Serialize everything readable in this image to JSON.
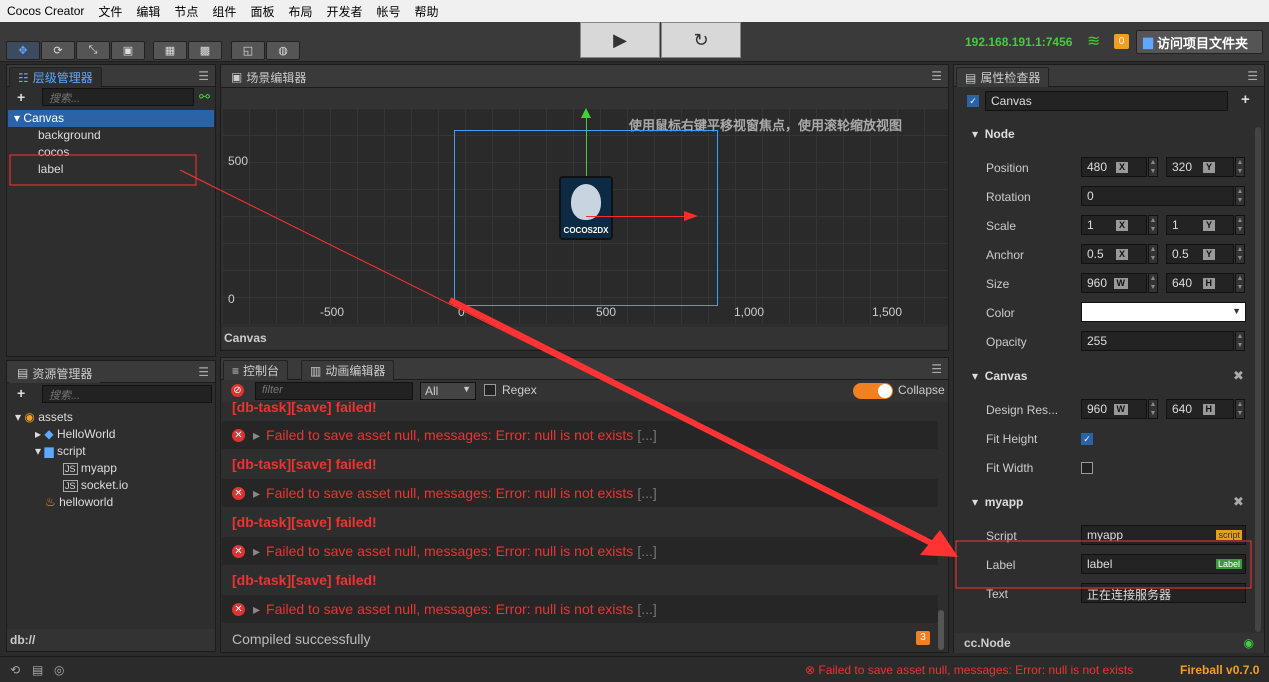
{
  "menubar": [
    "Cocos Creator",
    "文件",
    "编辑",
    "节点",
    "组件",
    "面板",
    "布局",
    "开发者",
    "帐号",
    "帮助"
  ],
  "toolbar": {
    "ip": "192.168.191.1:7456",
    "badge": "0",
    "open_project": "访问项目文件夹",
    "play": "▶",
    "refresh": "↻"
  },
  "hierarchy": {
    "tab": "层级管理器",
    "search_placeholder": "搜索...",
    "nodes": [
      "Canvas",
      "background",
      "cocos",
      "label"
    ]
  },
  "scene": {
    "tab": "场景编辑器",
    "hint": "使用鼠标右键平移视窗焦点，使用滚轮缩放视图",
    "y_labels": [
      "500",
      "0"
    ],
    "x_labels": [
      "-500",
      "0",
      "500",
      "1,000",
      "1,500"
    ],
    "footer": "Canvas",
    "logo_text": "COCOS2DX"
  },
  "assets": {
    "tab": "资源管理器",
    "search_placeholder": "搜索...",
    "items": [
      "assets",
      "HelloWorld",
      "script",
      "myapp",
      "socket.io",
      "helloworld"
    ],
    "footer": "db://"
  },
  "console": {
    "tab1": "控制台",
    "tab2": "动画编辑器",
    "filter_placeholder": "filter",
    "level": "All",
    "regex": "Regex",
    "collapse": "Collapse",
    "task_failed": "[db-task][save] failed!",
    "error_msg": "Failed to save asset null, messages: Error: null is not exists",
    "ellipsis": "[...]",
    "compiled": "Compiled successfully",
    "count": "3"
  },
  "inspector": {
    "tab": "属性检查器",
    "node_name": "Canvas",
    "sections": {
      "node": "Node",
      "canvas": "Canvas",
      "myapp": "myapp"
    },
    "props": {
      "position": "Position",
      "rotation": "Rotation",
      "scale": "Scale",
      "anchor": "Anchor",
      "size": "Size",
      "color": "Color",
      "opacity": "Opacity",
      "design_res": "Design Res...",
      "fit_height": "Fit Height",
      "fit_width": "Fit Width",
      "script": "Script",
      "label": "Label",
      "text": "Text"
    },
    "values": {
      "pos_x": "480",
      "pos_y": "320",
      "rotation": "0",
      "scale_x": "1",
      "scale_y": "1",
      "anchor_x": "0.5",
      "anchor_y": "0.5",
      "size_w": "960",
      "size_h": "640",
      "opacity": "255",
      "design_w": "960",
      "design_h": "640",
      "script": "myapp",
      "script_tag": "script",
      "label": "label",
      "label_tag": "Label",
      "text": "正在连接服务器"
    },
    "axis": {
      "x": "X",
      "y": "Y",
      "w": "W",
      "h": "H"
    },
    "footer": "cc.Node"
  },
  "statusbar": {
    "error": "Failed to save asset null, messages: Error: null is not exists",
    "version": "Fireball v0.7.0"
  },
  "colors": {
    "accent": "#5fa8ff",
    "error": "#e33333",
    "annotation": "#ff3333",
    "ip": "#3fcf3f"
  }
}
